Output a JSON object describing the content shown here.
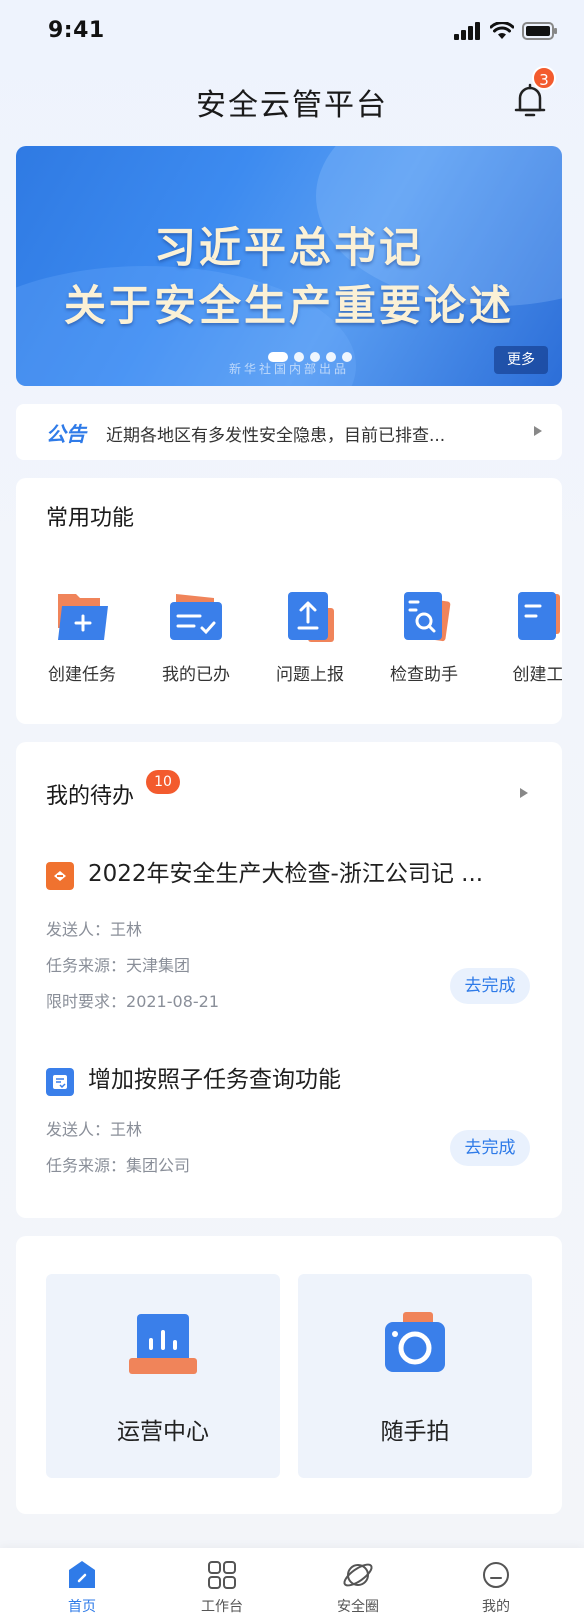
{
  "status_bar": {
    "time": "9:41"
  },
  "header": {
    "title": "安全云管平台",
    "notification_count": "3"
  },
  "banner": {
    "line1": "习近平总书记",
    "line2": "关于安全生产重要论述",
    "source": "新华社国内部出品",
    "more_label": "更多",
    "slide_count": 5,
    "active_slide": 1
  },
  "notice": {
    "tag": "公告",
    "text": "近期各地区有多发性安全隐患，目前已排查..."
  },
  "functions": {
    "title": "常用功能",
    "items": [
      {
        "label": "创建任务",
        "icon": "folder-add-icon"
      },
      {
        "label": "我的已办",
        "icon": "folder-check-icon"
      },
      {
        "label": "问题上报",
        "icon": "upload-icon"
      },
      {
        "label": "检查助手",
        "icon": "search-document-icon"
      },
      {
        "label": "创建工",
        "icon": "document-add-icon"
      }
    ]
  },
  "todo": {
    "title": "我的待办",
    "count": "10",
    "tasks": [
      {
        "title": "2022年安全生产大检查-浙江公司记 ...",
        "icon": "orange-shield-icon",
        "sender_label": "发送人：",
        "sender": "王林",
        "source_label": "任务来源：",
        "source": "天津集团",
        "deadline_label": "限时要求：",
        "deadline": "2021-08-21",
        "action": "去完成"
      },
      {
        "title": "增加按照子任务查询功能",
        "icon": "blue-document-icon",
        "sender_label": "发送人：",
        "sender": "王林",
        "source_label": "任务来源：",
        "source": "集团公司",
        "action": "去完成"
      }
    ]
  },
  "tools": [
    {
      "label": "运营中心",
      "icon": "chart-icon"
    },
    {
      "label": "随手拍",
      "icon": "camera-icon"
    }
  ],
  "tab_bar": [
    {
      "label": "首页",
      "icon": "home-icon",
      "active": true
    },
    {
      "label": "工作台",
      "icon": "grid-icon",
      "active": false
    },
    {
      "label": "安全圈",
      "icon": "planet-icon",
      "active": false
    },
    {
      "label": "我的",
      "icon": "user-icon",
      "active": false
    }
  ],
  "colors": {
    "primary": "#2f7be8",
    "badge": "#f35b2e",
    "accent_orange": "#f0845a"
  }
}
